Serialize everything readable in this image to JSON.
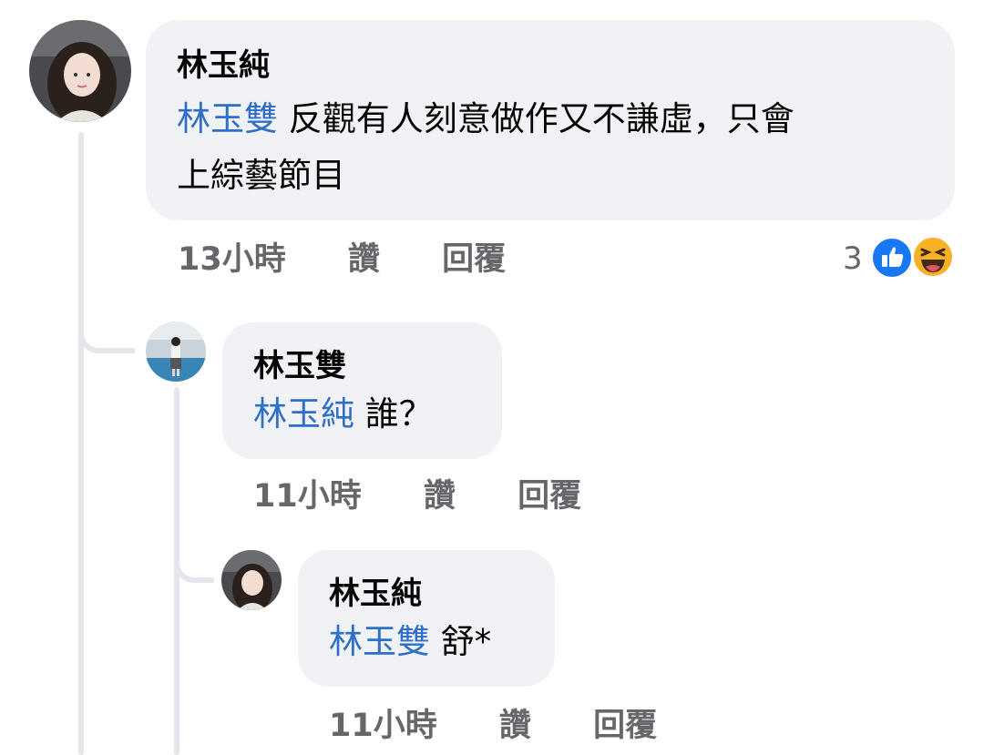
{
  "comments": [
    {
      "author": "林玉純",
      "mention": "林玉雙",
      "text_line1": " 反觀有人刻意做作又不謙虛，只會",
      "text_line2": "上綜藝節目",
      "time": "13小時",
      "like_label": "讚",
      "reply_label": "回覆",
      "reaction_count": "3",
      "reactions": [
        "like-icon",
        "haha-icon"
      ],
      "colors": {
        "like": "#1877f2",
        "haha": "#f7b125"
      }
    },
    {
      "author": "林玉雙",
      "mention": "林玉純",
      "text": " 誰？",
      "time": "11小時",
      "like_label": "讚",
      "reply_label": "回覆"
    },
    {
      "author": "林玉純",
      "mention": "林玉雙",
      "text": " 舒*",
      "time": "11小時",
      "like_label": "讚",
      "reply_label": "回覆"
    }
  ],
  "colors": {
    "mention": "#2e6fc7",
    "bubble": "#f0f2f5",
    "meta": "#65676b",
    "thread": "#e4e6eb"
  }
}
